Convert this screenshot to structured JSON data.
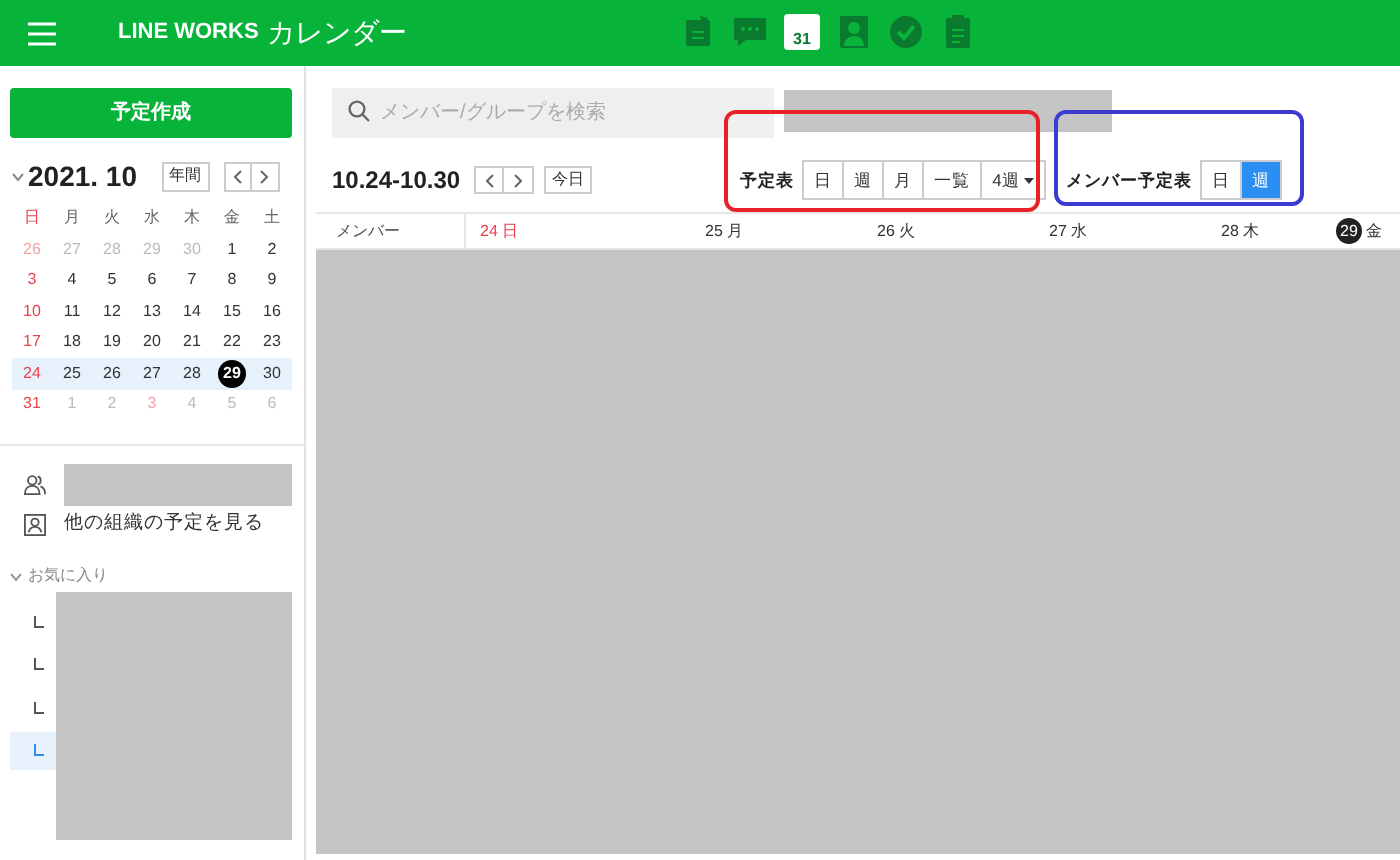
{
  "header": {
    "brand": "LINE WORKS",
    "app": "カレンダー",
    "apps": [
      {
        "kind": "note",
        "selected": false
      },
      {
        "kind": "chat",
        "selected": false
      },
      {
        "kind": "calendar",
        "selected": true,
        "label": "31"
      },
      {
        "kind": "contact",
        "selected": false
      },
      {
        "kind": "task",
        "selected": false
      },
      {
        "kind": "form",
        "selected": false
      }
    ]
  },
  "sidebar": {
    "create_button": "予定作成",
    "month_title": "2021. 10",
    "year_button": "年間",
    "weekdays": [
      {
        "label": "日",
        "holiday": true
      },
      {
        "label": "月",
        "holiday": false
      },
      {
        "label": "火",
        "holiday": false
      },
      {
        "label": "水",
        "holiday": false
      },
      {
        "label": "木",
        "holiday": false
      },
      {
        "label": "金",
        "holiday": false
      },
      {
        "label": "土",
        "holiday": false
      }
    ],
    "weeks": [
      {
        "highlighted": false,
        "days": [
          {
            "d": "26",
            "muted": true,
            "holiday": true,
            "selected": false
          },
          {
            "d": "27",
            "muted": true,
            "holiday": false,
            "selected": false
          },
          {
            "d": "28",
            "muted": true,
            "holiday": false,
            "selected": false
          },
          {
            "d": "29",
            "muted": true,
            "holiday": false,
            "selected": false
          },
          {
            "d": "30",
            "muted": true,
            "holiday": false,
            "selected": false
          },
          {
            "d": "1",
            "muted": false,
            "holiday": false,
            "selected": false
          },
          {
            "d": "2",
            "muted": false,
            "holiday": false,
            "selected": false
          }
        ]
      },
      {
        "highlighted": false,
        "days": [
          {
            "d": "3",
            "muted": false,
            "holiday": true,
            "selected": false
          },
          {
            "d": "4",
            "muted": false,
            "holiday": false,
            "selected": false
          },
          {
            "d": "5",
            "muted": false,
            "holiday": false,
            "selected": false
          },
          {
            "d": "6",
            "muted": false,
            "holiday": false,
            "selected": false
          },
          {
            "d": "7",
            "muted": false,
            "holiday": false,
            "selected": false
          },
          {
            "d": "8",
            "muted": false,
            "holiday": false,
            "selected": false
          },
          {
            "d": "9",
            "muted": false,
            "holiday": false,
            "selected": false
          }
        ]
      },
      {
        "highlighted": false,
        "days": [
          {
            "d": "10",
            "muted": false,
            "holiday": true,
            "selected": false
          },
          {
            "d": "11",
            "muted": false,
            "holiday": false,
            "selected": false
          },
          {
            "d": "12",
            "muted": false,
            "holiday": false,
            "selected": false
          },
          {
            "d": "13",
            "muted": false,
            "holiday": false,
            "selected": false
          },
          {
            "d": "14",
            "muted": false,
            "holiday": false,
            "selected": false
          },
          {
            "d": "15",
            "muted": false,
            "holiday": false,
            "selected": false
          },
          {
            "d": "16",
            "muted": false,
            "holiday": false,
            "selected": false
          }
        ]
      },
      {
        "highlighted": false,
        "days": [
          {
            "d": "17",
            "muted": false,
            "holiday": true,
            "selected": false
          },
          {
            "d": "18",
            "muted": false,
            "holiday": false,
            "selected": false
          },
          {
            "d": "19",
            "muted": false,
            "holiday": false,
            "selected": false
          },
          {
            "d": "20",
            "muted": false,
            "holiday": false,
            "selected": false
          },
          {
            "d": "21",
            "muted": false,
            "holiday": false,
            "selected": false
          },
          {
            "d": "22",
            "muted": false,
            "holiday": false,
            "selected": false
          },
          {
            "d": "23",
            "muted": false,
            "holiday": false,
            "selected": false
          }
        ]
      },
      {
        "highlighted": true,
        "days": [
          {
            "d": "24",
            "muted": false,
            "holiday": true,
            "selected": false
          },
          {
            "d": "25",
            "muted": false,
            "holiday": false,
            "selected": false
          },
          {
            "d": "26",
            "muted": false,
            "holiday": false,
            "selected": false
          },
          {
            "d": "27",
            "muted": false,
            "holiday": false,
            "selected": false
          },
          {
            "d": "28",
            "muted": false,
            "holiday": false,
            "selected": false
          },
          {
            "d": "29",
            "muted": false,
            "holiday": false,
            "selected": true
          },
          {
            "d": "30",
            "muted": false,
            "holiday": false,
            "selected": false
          }
        ]
      },
      {
        "highlighted": false,
        "days": [
          {
            "d": "31",
            "muted": false,
            "holiday": true,
            "selected": false
          },
          {
            "d": "1",
            "muted": true,
            "holiday": false,
            "selected": false
          },
          {
            "d": "2",
            "muted": true,
            "holiday": false,
            "selected": false
          },
          {
            "d": "3",
            "muted": true,
            "holiday": true,
            "selected": false
          },
          {
            "d": "4",
            "muted": true,
            "holiday": false,
            "selected": false
          },
          {
            "d": "5",
            "muted": true,
            "holiday": false,
            "selected": false
          },
          {
            "d": "6",
            "muted": true,
            "holiday": false,
            "selected": false
          }
        ]
      }
    ],
    "other_org_link": "他の組織の予定を見る",
    "favorites": {
      "title": "お気に入り",
      "expanded": true,
      "items": [
        {
          "selected": false
        },
        {
          "selected": false
        },
        {
          "selected": false
        },
        {
          "selected": true
        }
      ]
    }
  },
  "main": {
    "search": {
      "placeholder": "メンバー/グループを検索"
    },
    "range": "10.24-10.30",
    "today_button": "今日",
    "schedule_label": "予定表",
    "schedule_views": [
      {
        "label": "日",
        "selected": false
      },
      {
        "label": "週",
        "selected": false
      },
      {
        "label": "月",
        "selected": false
      },
      {
        "label": "一覧",
        "selected": false
      },
      {
        "label": "4週",
        "selected": false,
        "dropdown": true
      }
    ],
    "member_label": "メンバー予定表",
    "member_views": [
      {
        "label": "日",
        "selected": false
      },
      {
        "label": "週",
        "selected": true
      }
    ],
    "member_column": "メンバー",
    "days": [
      {
        "date": "24",
        "weekday": "日",
        "holiday": true,
        "today": false
      },
      {
        "date": "25",
        "weekday": "月",
        "holiday": false,
        "today": false
      },
      {
        "date": "26",
        "weekday": "火",
        "holiday": false,
        "today": false
      },
      {
        "date": "27",
        "weekday": "水",
        "holiday": false,
        "today": false
      },
      {
        "date": "28",
        "weekday": "木",
        "holiday": false,
        "today": false
      },
      {
        "date": "29",
        "weekday": "金",
        "holiday": false,
        "today": true
      }
    ]
  }
}
